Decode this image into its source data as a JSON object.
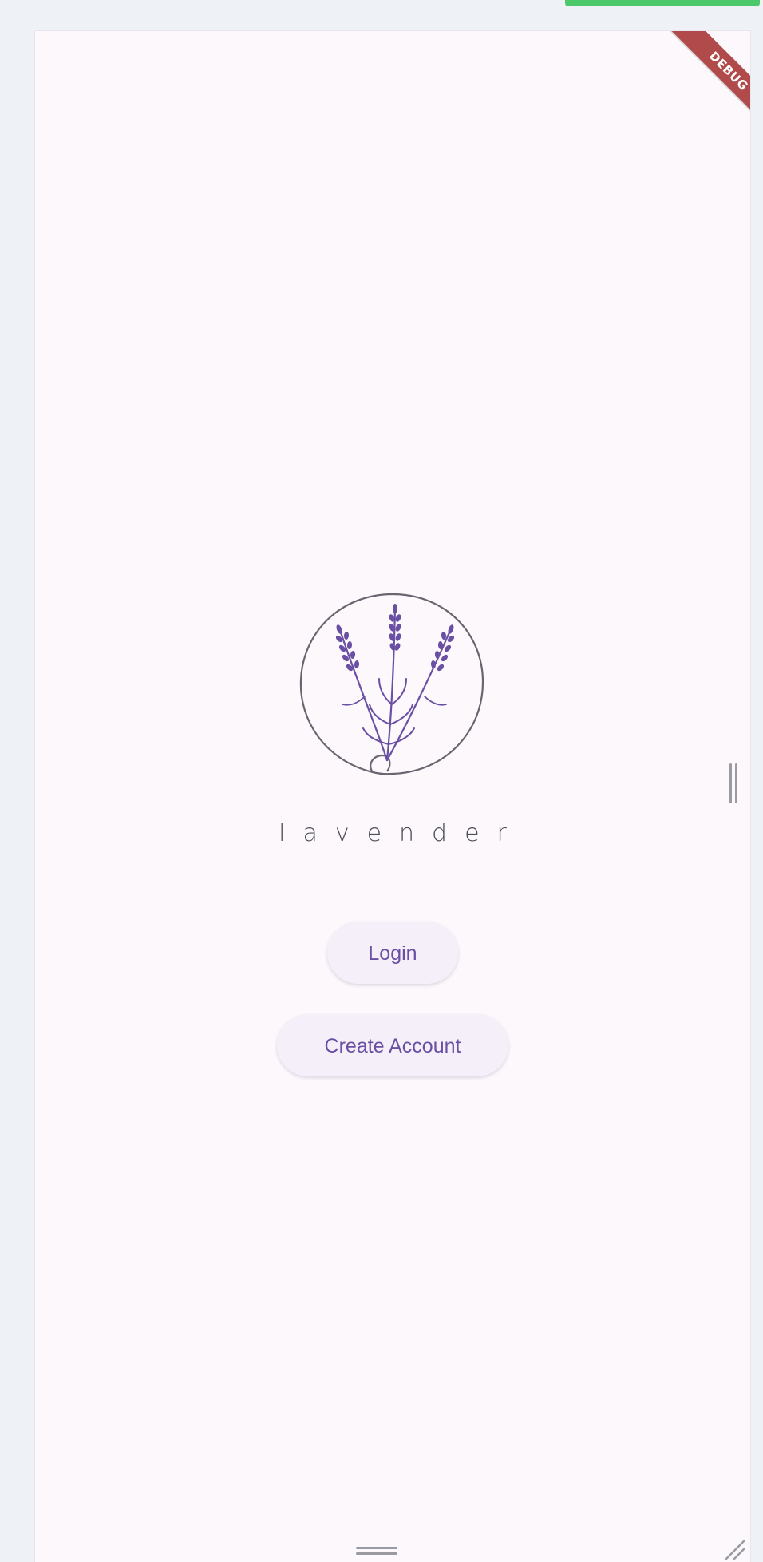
{
  "app": {
    "name": "lavender",
    "debug_banner": "DEBUG"
  },
  "actions": {
    "login_label": "Login",
    "create_account_label": "Create Account"
  },
  "icons": {
    "logo": "lavender-sprig-logo-icon",
    "side_handle": "vertical-drag-handle-icon",
    "bottom_handle": "horizontal-drag-handle-icon",
    "resize": "resize-grip-icon"
  },
  "colors": {
    "background": "#fcf8fc",
    "accent": "#6a4fa3",
    "button_bg": "#f4eff8",
    "debug_banner": "#b14a4a",
    "progress": "#4cc86a"
  }
}
